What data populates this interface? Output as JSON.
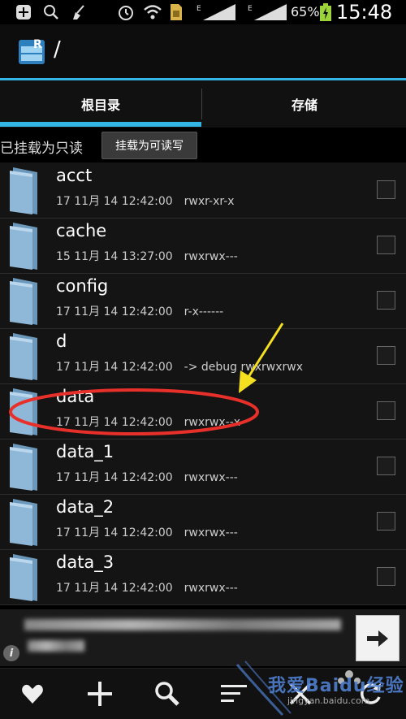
{
  "status_bar": {
    "battery_pct": "65%",
    "time": "15:48"
  },
  "title_bar": {
    "path": "/"
  },
  "tabs": [
    {
      "label": "根目录"
    },
    {
      "label": "存储"
    }
  ],
  "mount": {
    "status": "已挂载为只读",
    "button_label": "挂载为可读写"
  },
  "files": [
    {
      "name": "acct",
      "date": "17 11月 14 12:42:00",
      "perm": "rwxr-xr-x"
    },
    {
      "name": "cache",
      "date": "15 11月 14 13:27:00",
      "perm": "rwxrwx---"
    },
    {
      "name": "config",
      "date": "17 11月 14 12:42:00",
      "perm": "r-x------"
    },
    {
      "name": "d",
      "date": "17 11月 14 12:42:00",
      "perm": "-> debug  rwxrwxrwx"
    },
    {
      "name": "data",
      "date": "17 11月 14 12:42:00",
      "perm": "rwxrwx--x"
    },
    {
      "name": "data_1",
      "date": "17 11月 14 12:42:00",
      "perm": "rwxrwx---"
    },
    {
      "name": "data_2",
      "date": "17 11月 14 12:42:00",
      "perm": "rwxrwx---"
    },
    {
      "name": "data_3",
      "date": "17 11月 14 12:42:00",
      "perm": "rwxrwx---"
    }
  ],
  "watermark": {
    "text": "我爱Baidu经验",
    "sub": "jingyan.baidu.com"
  },
  "colors": {
    "accent": "#33b5e5",
    "annotation_red": "#e8302a",
    "annotation_yellow": "#f4e021",
    "folder": "#8fb8d8"
  },
  "icons": {
    "status": [
      "plus-icon",
      "search-icon",
      "broom-icon",
      "alarm-icon",
      "wifi-icon",
      "sim-icon",
      "signal-icon",
      "battery-icon"
    ],
    "toolbar": [
      "heart-icon",
      "plus-icon",
      "search-icon",
      "sort-icon",
      "close-icon",
      "refresh-icon"
    ]
  }
}
